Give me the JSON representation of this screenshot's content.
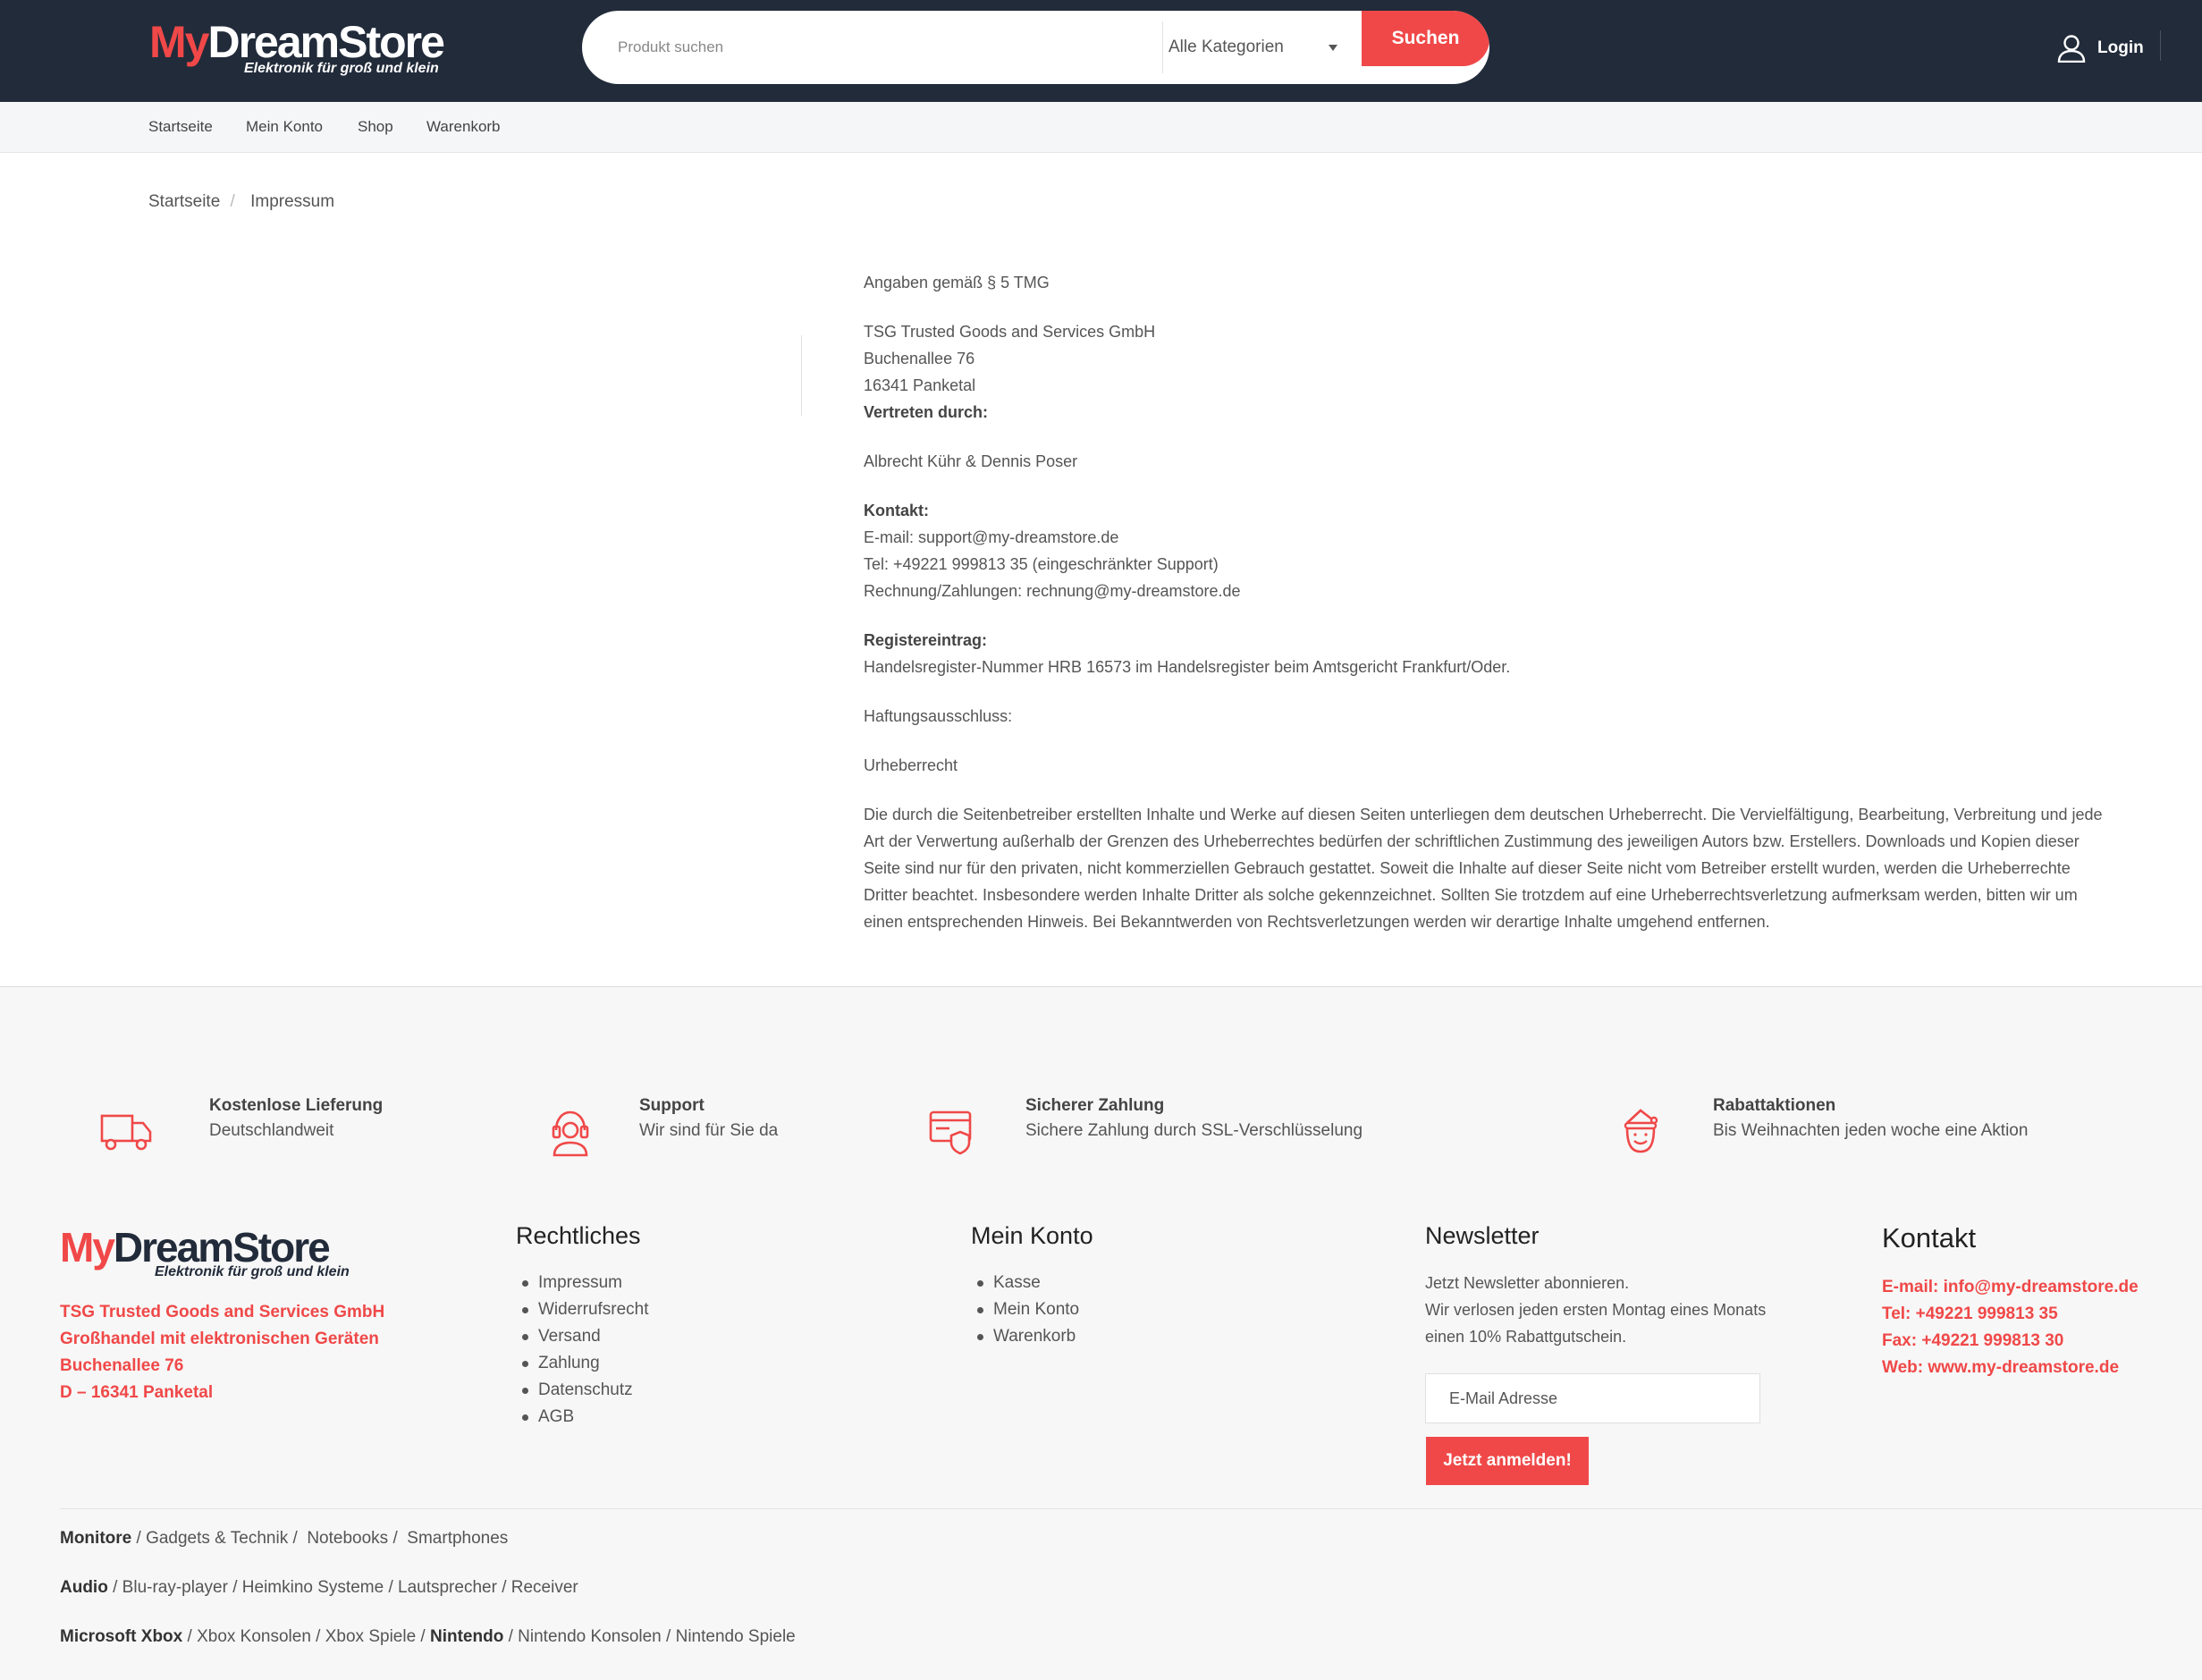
{
  "header": {
    "logo": {
      "my": "My",
      "dreamstore": "DreamStore",
      "tagline": "Elektronik für groß und klein"
    },
    "search": {
      "placeholder": "Produkt suchen",
      "category": "Alle Kategorien",
      "button": "Suchen"
    },
    "login": "Login"
  },
  "nav": [
    "Startseite",
    "Mein Konto",
    "Shop",
    "Warenkorb"
  ],
  "breadcrumb": {
    "home": "Startseite",
    "sep": "/",
    "current": "Impressum"
  },
  "content": {
    "heading": "Angaben gemäß § 5 TMG",
    "company": "TSG Trusted Goods and Services GmbH",
    "street": "Buchenallee 76",
    "city": "16341 Panketal",
    "represented_label": "Vertreten durch:",
    "represented": "Albrecht Kühr & Dennis Poser",
    "contact_label": "Kontakt:",
    "email": "E-mail: support@my-dreamstore.de",
    "tel": "Tel: +49221 999813 35 (eingeschränkter Support)",
    "billing": "Rechnung/Zahlungen: rechnung@my-dreamstore.de",
    "register_label": "Registereintrag:",
    "register": "Handelsregister-Nummer HRB 16573 im Handelsregister beim Amtsgericht Frankfurt/Oder.",
    "liability_label": "Haftungsausschluss:",
    "copyright_label": "Urheberrecht",
    "copyright_lines": [
      "Die durch die Seitenbetreiber erstellten Inhalte und Werke auf diesen Seiten unterliegen dem deutschen Urheberrecht. Die Vervielfältigung, Bearbeitung, Verbreitung und jede",
      "Art der Verwertung außerhalb der Grenzen des Urheberrechtes bedürfen der schriftlichen Zustimmung des jeweiligen Autors bzw. Erstellers. Downloads und Kopien dieser",
      "Seite sind nur für den privaten, nicht kommerziellen Gebrauch gestattet. Soweit die Inhalte auf dieser Seite nicht vom Betreiber erstellt wurden, werden die Urheberrechte",
      "Dritter beachtet. Insbesondere werden Inhalte Dritter als solche gekennzeichnet. Sollten Sie trotzdem auf eine Urheberrechtsverletzung aufmerksam werden, bitten wir um",
      "einen entsprechenden Hinweis. Bei Bekanntwerden von Rechtsverletzungen werden wir derartige Inhalte umgehend entfernen."
    ]
  },
  "features": [
    {
      "title": "Kostenlose Lieferung",
      "sub": "Deutschlandweit",
      "icon": "truck-icon"
    },
    {
      "title": "Support",
      "sub": "Wir sind für Sie da",
      "icon": "headset-icon"
    },
    {
      "title": "Sicherer Zahlung",
      "sub": "Sichere Zahlung durch SSL-Verschlüsselung",
      "icon": "secure-card-icon"
    },
    {
      "title": "Rabattaktionen",
      "sub": "Bis Weihnachten jeden woche eine Aktion",
      "icon": "santa-icon"
    }
  ],
  "footer": {
    "address": [
      "TSG Trusted Goods and Services GmbH",
      "Großhandel mit elektronischen Geräten",
      "Buchenallee 76",
      "D – 16341 Panketal"
    ],
    "legal_title": "Rechtliches",
    "legal_items": [
      "Impressum",
      "Widerrufsrecht",
      "Versand",
      "Zahlung",
      "Datenschutz",
      "AGB"
    ],
    "account_title": "Mein Konto",
    "account_items": [
      "Kasse",
      "Mein Konto",
      "Warenkorb"
    ],
    "newsletter_title": "Newsletter",
    "newsletter_text": [
      "Jetzt Newsletter abonnieren.",
      "Wir verlosen jeden ersten Montag eines Monats",
      "einen 10% Rabattgutschein."
    ],
    "newsletter_placeholder": "E-Mail Adresse",
    "newsletter_button": "Jetzt anmelden!",
    "contact_title": "Kontakt",
    "contact_items": [
      "E-mail: info@my-dreamstore.de",
      "Tel: +49221 999813 35",
      "Fax: +49221 999813 30",
      "Web: www.my-dreamstore.de"
    ]
  },
  "categories": {
    "row1": [
      "Monitore",
      "Gadgets & Technik",
      "Notebooks",
      "Smartphones"
    ],
    "row2": [
      "Audio",
      "Blu-ray-player",
      "Heimkino Systeme",
      "Lautsprecher",
      "Receiver"
    ],
    "row3": [
      "Microsoft Xbox",
      "Xbox Konsolen",
      "Xbox Spiele",
      "Nintendo",
      "Nintendo Konsolen",
      "Nintendo Spiele"
    ]
  },
  "colors": {
    "accent": "#f04848",
    "header_bg": "#222b3a"
  }
}
